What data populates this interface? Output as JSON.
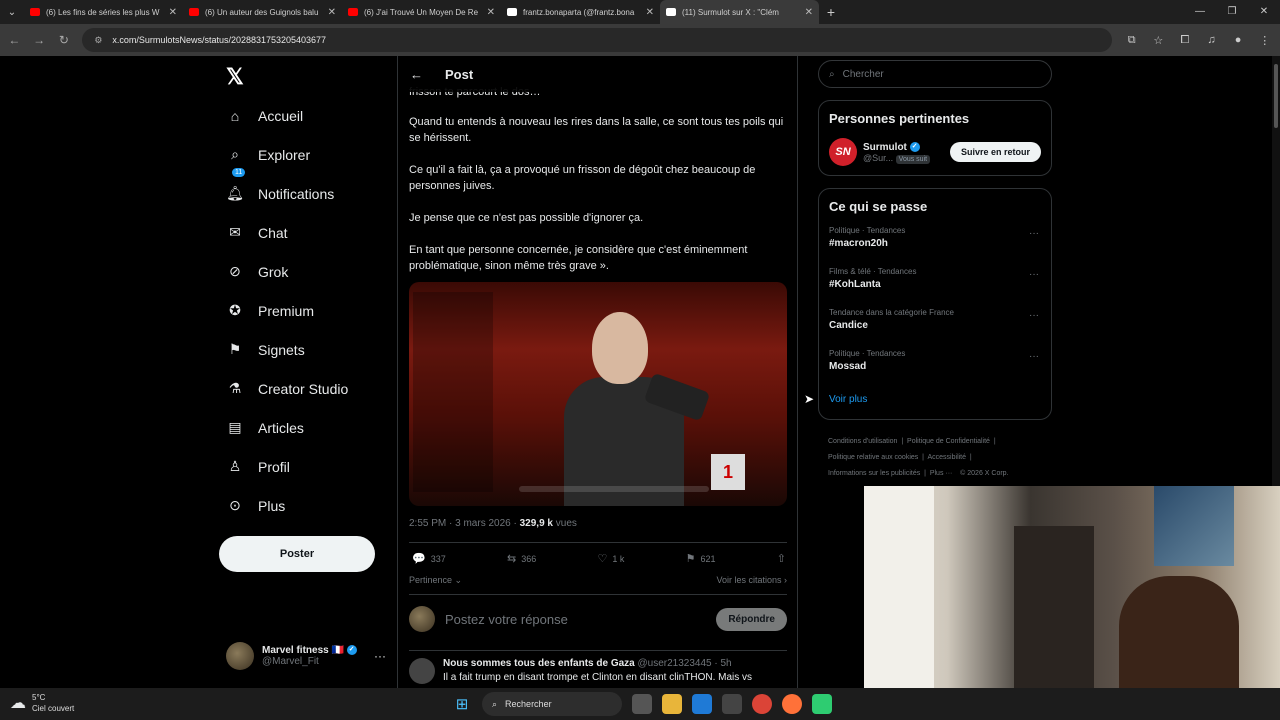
{
  "browser": {
    "tabs": [
      {
        "title": "(6) Les fins de séries les plus W",
        "icon": "youtube-icon",
        "color": "#ff0000",
        "active": false
      },
      {
        "title": "(6) Un auteur des Guignols balu",
        "icon": "youtube-icon",
        "color": "#ff0000",
        "active": false
      },
      {
        "title": "(6) J'ai Trouvé Un Moyen De Re",
        "icon": "youtube-icon",
        "color": "#ff0000",
        "active": false
      },
      {
        "title": "frantz.bonaparta (@frantz.bona",
        "icon": "tiktok-icon",
        "color": "#ffffff",
        "active": false
      },
      {
        "title": "(11) Surmulot sur X : \"Clém",
        "icon": "x-icon",
        "color": "#ffffff",
        "active": true
      }
    ],
    "url": "x.com/SurmulotsNews/status/2028831753205403677"
  },
  "nav": {
    "items": [
      {
        "label": "Accueil",
        "icon": "home-icon"
      },
      {
        "label": "Explorer",
        "icon": "search-icon"
      },
      {
        "label": "Notifications",
        "icon": "bell-icon",
        "badge": "11"
      },
      {
        "label": "Chat",
        "icon": "mail-icon"
      },
      {
        "label": "Grok",
        "icon": "grok-icon"
      },
      {
        "label": "Premium",
        "icon": "verified-icon"
      },
      {
        "label": "Signets",
        "icon": "bookmark-icon"
      },
      {
        "label": "Creator Studio",
        "icon": "flask-icon"
      },
      {
        "label": "Articles",
        "icon": "article-icon"
      },
      {
        "label": "Profil",
        "icon": "person-icon"
      },
      {
        "label": "Plus",
        "icon": "more-circle-icon"
      }
    ],
    "post_button": "Poster",
    "account": {
      "name": "Marvel fitness 🇫🇷",
      "handle": "@Marvel_Fit"
    }
  },
  "post": {
    "header_title": "Post",
    "paragraphs": [
      "frisson te parcourt le dos…",
      "Quand tu entends à nouveau les rires dans la salle, ce sont tous tes poils qui se hérissent.",
      "Ce qu'il a fait là, ça a provoqué un frisson de dégoût chez beaucoup de personnes juives.",
      "Je pense que ce n'est pas possible d'ignorer ça.",
      "En tant que personne concernée, je considère que c'est éminemment problématique, sinon même très grave »."
    ],
    "time": "2:55 PM · 3 mars 2026 · ",
    "views_count": "329,9 k",
    "views_label": " vues",
    "stats": {
      "replies": "337",
      "reposts": "366",
      "likes": "1 k",
      "bookmarks": "621"
    },
    "sort_label": "Pertinence",
    "quotes_label": "Voir les citations",
    "reply_placeholder": "Postez votre réponse",
    "reply_button": "Répondre",
    "comment": {
      "name": "Nous sommes tous des enfants de Gaza",
      "handle": "@user21323445 · 5h",
      "text": "Il a fait trump en disant trompe et Clinton en disant clinTHON. Mais vs"
    }
  },
  "sidebar": {
    "search_placeholder": "Chercher",
    "relevant_title": "Personnes pertinentes",
    "relevant_person": {
      "logo": "SN",
      "name": "Surmulot",
      "handle": "@Sur...",
      "follows_you": "Vous suit",
      "button": "Suivre en retour"
    },
    "trends_title": "Ce qui se passe",
    "trends": [
      {
        "context": "Politique · Tendances",
        "name": "#macron20h"
      },
      {
        "context": "Films & télé · Tendances",
        "name": "#KohLanta"
      },
      {
        "context": "Tendance dans la catégorie France",
        "name": "Candice"
      },
      {
        "context": "Politique · Tendances",
        "name": "Mossad"
      }
    ],
    "show_more": "Voir plus",
    "footer": {
      "line1a": "Conditions d'utilisation",
      "line1b": "Politique de Confidentialité",
      "line2a": "Politique relative aux cookies",
      "line2b": "Accessibilité",
      "line3a": "Informations sur les publicités",
      "line3b": "Plus ···",
      "line3c": "© 2026 X Corp."
    }
  },
  "taskbar": {
    "temp": "5°C",
    "weather": "Ciel couvert",
    "search": "Rechercher"
  }
}
